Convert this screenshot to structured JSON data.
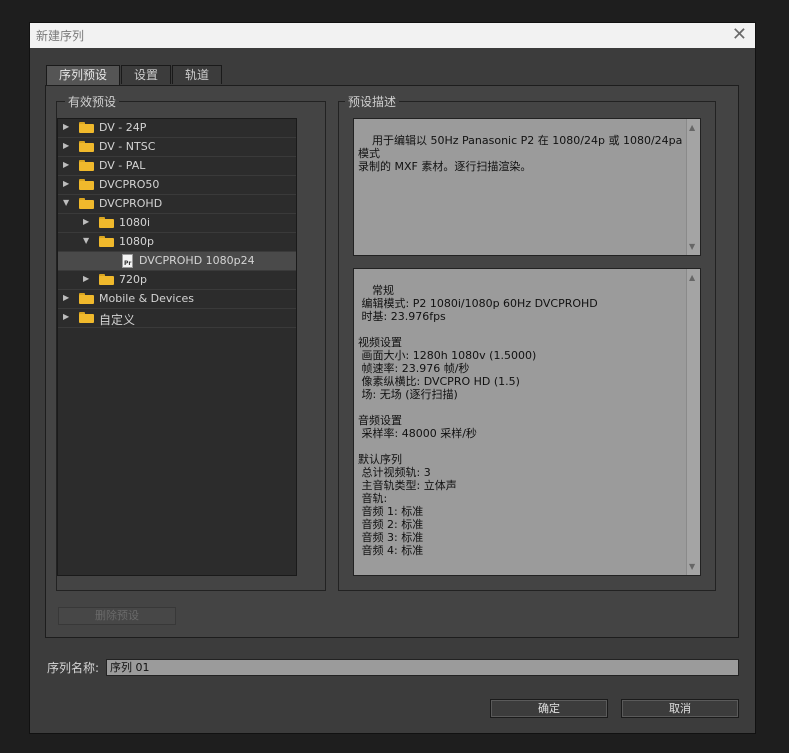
{
  "window": {
    "title": "新建序列",
    "close_glyph": "✕"
  },
  "tabs": [
    {
      "label": "序列预设",
      "active": true
    },
    {
      "label": "设置",
      "active": false
    },
    {
      "label": "轨道",
      "active": false
    }
  ],
  "presets_group": {
    "label": "有效预设",
    "tree": [
      {
        "label": "DV - 24P",
        "expanded": false,
        "type": "folder",
        "level": 0
      },
      {
        "label": "DV - NTSC",
        "expanded": false,
        "type": "folder",
        "level": 0
      },
      {
        "label": "DV - PAL",
        "expanded": false,
        "type": "folder",
        "level": 0
      },
      {
        "label": "DVCPRO50",
        "expanded": false,
        "type": "folder",
        "level": 0
      },
      {
        "label": "DVCPROHD",
        "expanded": true,
        "type": "folder",
        "level": 0
      },
      {
        "label": "1080i",
        "expanded": false,
        "type": "folder",
        "level": 1
      },
      {
        "label": "1080p",
        "expanded": true,
        "type": "folder",
        "level": 1
      },
      {
        "label": "DVCPROHD 1080p24",
        "type": "preset",
        "level": 2,
        "selected": true,
        "icon_tag": "Pr"
      },
      {
        "label": "720p",
        "expanded": false,
        "type": "folder",
        "level": 1
      },
      {
        "label": "Mobile & Devices",
        "expanded": false,
        "type": "folder",
        "level": 0
      },
      {
        "label": "自定义",
        "expanded": false,
        "type": "folder",
        "level": 0
      }
    ]
  },
  "description_group": {
    "label": "预设描述",
    "description": "用于编辑以 50Hz Panasonic P2 在 1080/24p 或 1080/24pa 模式\n录制的 MXF 素材。逐行扫描渲染。",
    "details": "常规\n 编辑模式: P2 1080i/1080p 60Hz DVCPROHD\n 时基: 23.976fps\n\n视频设置\n 画面大小: 1280h 1080v (1.5000)\n 帧速率: 23.976 帧/秒\n 像素纵横比: DVCPRO HD (1.5)\n 场: 无场 (逐行扫描)\n\n音频设置\n 采样率: 48000 采样/秒\n\n默认序列\n 总计视频轨: 3\n 主音轨类型: 立体声\n 音轨:\n 音频 1: 标准\n 音频 2: 标准\n 音频 3: 标准\n 音频 4: 标准"
  },
  "delete_preset_label": "删除预设",
  "sequence_name": {
    "label": "序列名称:",
    "value": "序列 01"
  },
  "buttons": {
    "ok": "确定",
    "cancel": "取消"
  },
  "colors": {
    "dialog_bg": "#3c3c3c",
    "folder": "#f0b92c",
    "textbox_bg": "#9b9b9b"
  },
  "icons": {
    "expand_closed": "▶",
    "expand_open": "▼",
    "scroll_up": "▲",
    "scroll_down": "▼"
  }
}
